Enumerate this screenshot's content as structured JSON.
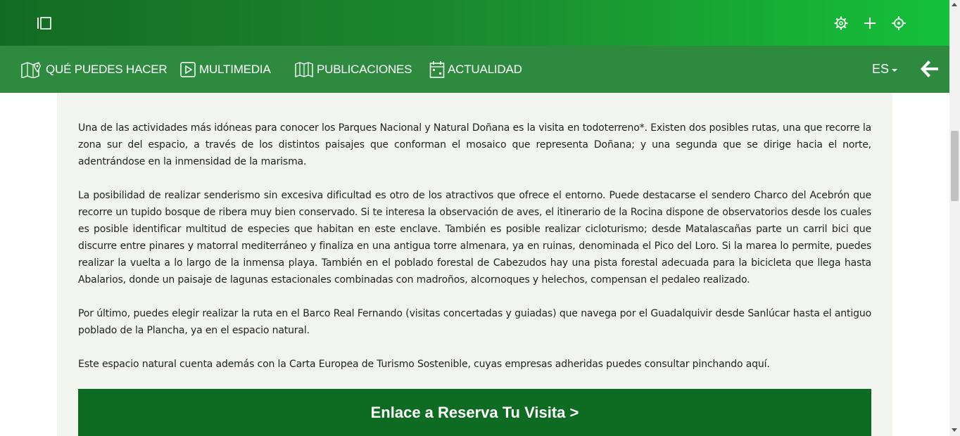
{
  "nav": {
    "items": [
      {
        "label": "QUÉ PUEDES HACER",
        "icon": "map-icon"
      },
      {
        "label": "MULTIMEDIA",
        "icon": "play-icon"
      },
      {
        "label": "PUBLICACIONES",
        "icon": "book-icon"
      },
      {
        "label": "ACTUALIDAD",
        "icon": "calendar-icon"
      }
    ],
    "language": "ES"
  },
  "topbar": {
    "icons": [
      "sidebar-toggle-icon",
      "gear-icon",
      "plus-icon",
      "crosshair-icon"
    ]
  },
  "content": {
    "paragraphs": [
      "Una de las actividades más idóneas para conocer los Parques Nacional y Natural Doñana es la visita en todoterreno*. Existen dos posibles rutas, una que recorre la zona sur del espacio, a través de los distintos paisajes que conforman el mosaico que representa Doñana; y una segunda que se dirige hacia el norte, adentrándose en la inmensidad de la marisma.",
      "La posibilidad de realizar senderismo sin excesiva dificultad es otro de los atractivos que ofrece el entorno. Puede destacarse el sendero Charco del Acebrón que recorre un tupido bosque de ribera muy bien conservado. Si te interesa la observación de aves, el itinerario de la Rocina dispone de observatorios desde los cuales es posible identificar multitud de especies que habitan en este enclave. También es posible realizar cicloturismo; desde Matalascañas parte un carril bici que discurre entre pinares y matorral mediterráneo y finaliza en una antigua torre almenara, ya en ruinas, denominada el Pico del Loro. Si la marea lo permite, puedes realizar la vuelta a lo largo de la inmensa playa. También en el poblado forestal de Cabezudos hay una pista forestal adecuada para la bicicleta que llega hasta Abalarios, donde un paisaje de lagunas estacionales combinadas con madroños, alcornoques y helechos, compensan el pedaleo realizado.",
      "Por último, puedes elegir realizar la ruta en el Barco Real Fernando (visitas concertadas y guiadas) que navega por el Guadalquivir desde Sanlúcar hasta el antiguo poblado de la Plancha, ya en el espacio natural.",
      "Este espacio natural cuenta además con la Carta Europea de Turismo Sostenible, cuyas empresas adheridas puedes consultar pinchando aquí."
    ],
    "cta_label": "Enlace a Reserva Tu Visita >"
  },
  "colors": {
    "topbar_start": "#136b23",
    "topbar_end": "#14c13a",
    "navbar": "#2d8a3e",
    "content_bg": "#f1f4ef",
    "cta_bg": "#0e6b22"
  }
}
